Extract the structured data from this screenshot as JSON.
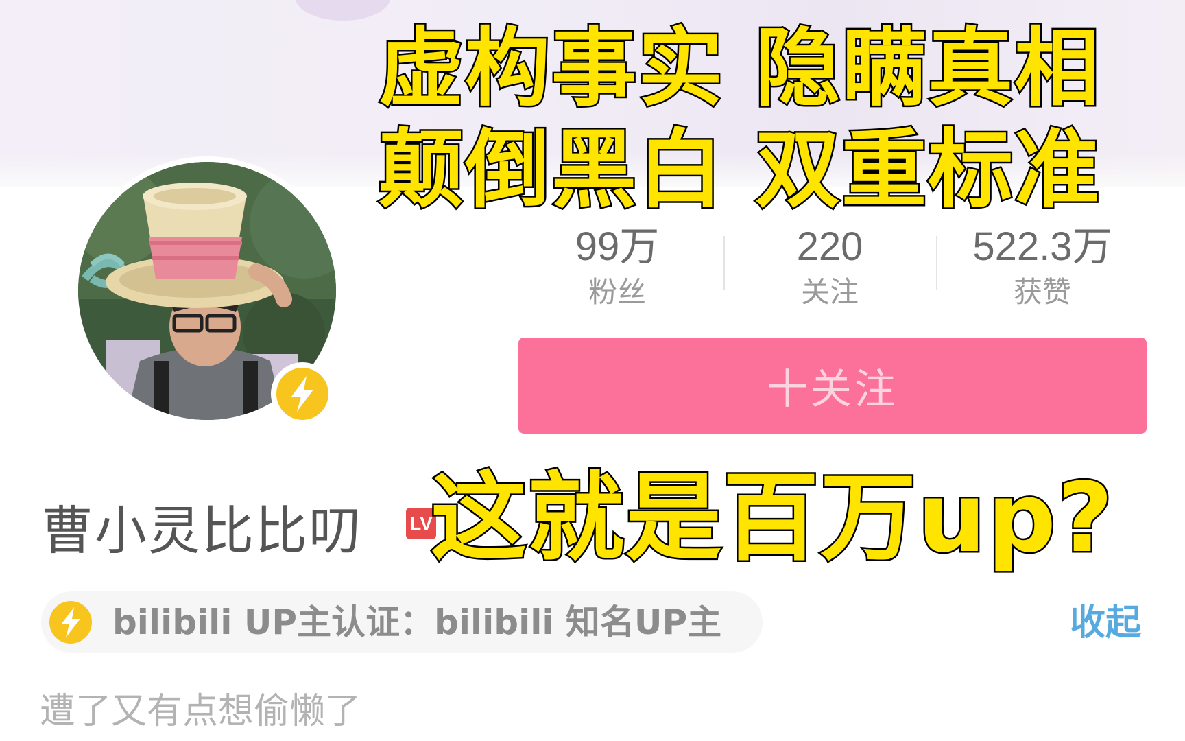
{
  "profile": {
    "username": "曹小灵比比叨",
    "level_badge": "LV",
    "bio": "遭了又有点想偷懒了"
  },
  "stats": [
    {
      "value": "99万",
      "label": "粉丝"
    },
    {
      "value": "220",
      "label": "关注"
    },
    {
      "value": "522.3万",
      "label": "获赞"
    }
  ],
  "actions": {
    "follow_label": "十关注",
    "collapse_label": "收起"
  },
  "verification": {
    "text": "bilibili UP主认证：bilibili 知名UP主"
  },
  "overlay": {
    "line1": "虚构事实  隐瞒真相",
    "line2": "颠倒黑白  双重标准",
    "line3": "这就是百万up?"
  },
  "colors": {
    "accent_pink": "#fb7199",
    "link_blue": "#56aae0",
    "badge_yellow": "#f7c51d",
    "overlay_yellow": "#ffe400"
  },
  "icons": {
    "badge": "lightning-icon",
    "verify": "lightning-icon"
  }
}
